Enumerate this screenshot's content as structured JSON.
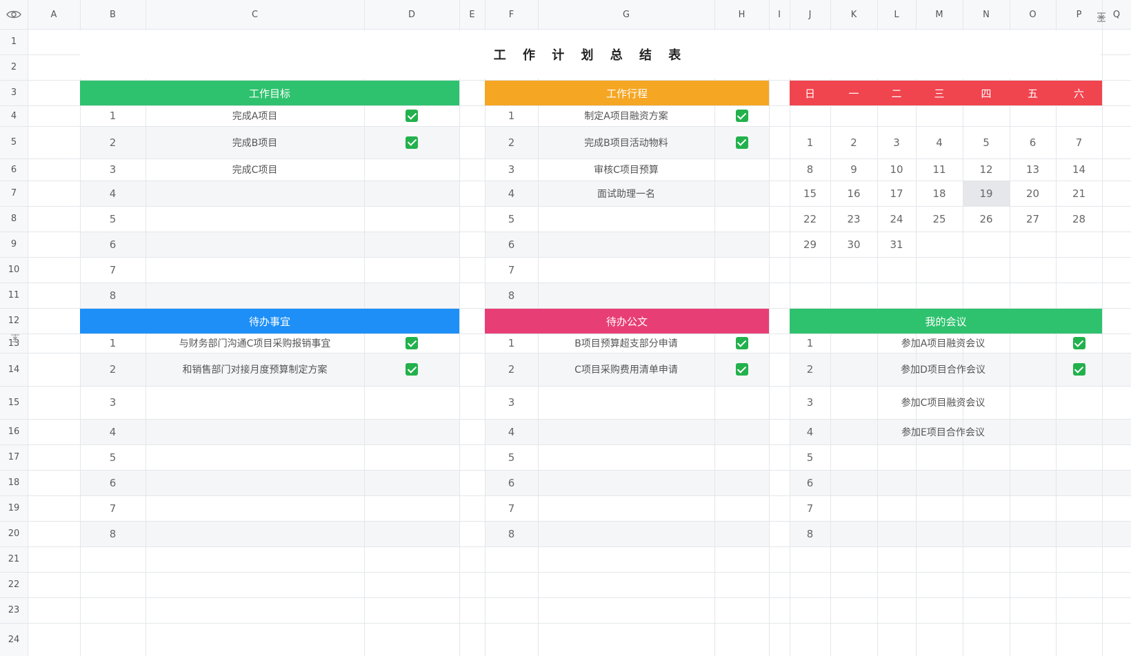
{
  "columns": [
    "A",
    "B",
    "C",
    "D",
    "E",
    "F",
    "G",
    "H",
    "I",
    "J",
    "K",
    "L",
    "M",
    "N",
    "O",
    "P",
    "Q"
  ],
  "rows": [
    "1",
    "2",
    "3",
    "4",
    "5",
    "6",
    "7",
    "8",
    "9",
    "10",
    "11",
    "12",
    "13",
    "14",
    "15",
    "16",
    "17",
    "18",
    "19",
    "20",
    "21",
    "22",
    "23",
    "24"
  ],
  "title": "工 作 计 划 总 结 表",
  "work_goals": {
    "header": "工作目标",
    "items": [
      {
        "no": "1",
        "text": "完成A项目",
        "done": true
      },
      {
        "no": "2",
        "text": "完成B项目",
        "done": true
      },
      {
        "no": "3",
        "text": "完成C项目",
        "done": false
      },
      {
        "no": "4",
        "text": "",
        "done": false
      },
      {
        "no": "5",
        "text": "",
        "done": false
      },
      {
        "no": "6",
        "text": "",
        "done": false
      },
      {
        "no": "7",
        "text": "",
        "done": false
      },
      {
        "no": "8",
        "text": "",
        "done": false
      }
    ]
  },
  "work_schedule": {
    "header": "工作行程",
    "items": [
      {
        "no": "1",
        "text": "制定A项目融资方案",
        "done": true
      },
      {
        "no": "2",
        "text": "完成B项目活动物料",
        "done": true
      },
      {
        "no": "3",
        "text": "审核C项目预算",
        "done": false
      },
      {
        "no": "4",
        "text": "面试助理一名",
        "done": false
      },
      {
        "no": "5",
        "text": "",
        "done": false
      },
      {
        "no": "6",
        "text": "",
        "done": false
      },
      {
        "no": "7",
        "text": "",
        "done": false
      },
      {
        "no": "8",
        "text": "",
        "done": false
      }
    ]
  },
  "calendar": {
    "weekdays": [
      "日",
      "一",
      "二",
      "三",
      "四",
      "五",
      "六"
    ],
    "weeks": [
      [
        "",
        "",
        "",
        "",
        "",
        "",
        ""
      ],
      [
        "1",
        "2",
        "3",
        "4",
        "5",
        "6",
        "7"
      ],
      [
        "8",
        "9",
        "10",
        "11",
        "12",
        "13",
        "14"
      ],
      [
        "15",
        "16",
        "17",
        "18",
        "19",
        "20",
        "21"
      ],
      [
        "22",
        "23",
        "24",
        "25",
        "26",
        "27",
        "28"
      ],
      [
        "29",
        "30",
        "31",
        "",
        "",
        "",
        ""
      ],
      [
        "",
        "",
        "",
        "",
        "",
        "",
        ""
      ],
      [
        "",
        "",
        "",
        "",
        "",
        "",
        ""
      ]
    ],
    "selected": "19"
  },
  "todo": {
    "header": "待办事宜",
    "items": [
      {
        "no": "1",
        "text": "与财务部门沟通C项目采购报销事宜",
        "done": true
      },
      {
        "no": "2",
        "text": "和销售部门对接月度预算制定方案",
        "done": true
      },
      {
        "no": "3",
        "text": "",
        "done": false
      },
      {
        "no": "4",
        "text": "",
        "done": false
      },
      {
        "no": "5",
        "text": "",
        "done": false
      },
      {
        "no": "6",
        "text": "",
        "done": false
      },
      {
        "no": "7",
        "text": "",
        "done": false
      },
      {
        "no": "8",
        "text": "",
        "done": false
      }
    ]
  },
  "documents": {
    "header": "待办公文",
    "items": [
      {
        "no": "1",
        "text": "B项目预算超支部分申请",
        "done": true
      },
      {
        "no": "2",
        "text": "C项目采购费用清单申请",
        "done": true
      },
      {
        "no": "3",
        "text": "",
        "done": false
      },
      {
        "no": "4",
        "text": "",
        "done": false
      },
      {
        "no": "5",
        "text": "",
        "done": false
      },
      {
        "no": "6",
        "text": "",
        "done": false
      },
      {
        "no": "7",
        "text": "",
        "done": false
      },
      {
        "no": "8",
        "text": "",
        "done": false
      }
    ]
  },
  "meetings": {
    "header": "我的会议",
    "items": [
      {
        "no": "1",
        "text": "参加A项目融资会议",
        "done": true
      },
      {
        "no": "2",
        "text": "参加D项目合作会议",
        "done": true
      },
      {
        "no": "3",
        "text": "参加C项目融资会议",
        "done": false
      },
      {
        "no": "4",
        "text": "参加E项目合作会议",
        "done": false
      },
      {
        "no": "5",
        "text": "",
        "done": false
      },
      {
        "no": "6",
        "text": "",
        "done": false
      },
      {
        "no": "7",
        "text": "",
        "done": false
      },
      {
        "no": "8",
        "text": "",
        "done": false
      }
    ]
  },
  "colors": {
    "goals": "#2ec26e",
    "schedule": "#f5a623",
    "calendar": "#f0444e",
    "todo": "#1d8ff7",
    "documents": "#e83e76",
    "meetings": "#2ec26e",
    "check": "#22b14c"
  },
  "icons": {
    "visibility": "eye-icon",
    "freeze": "freeze-icon"
  }
}
